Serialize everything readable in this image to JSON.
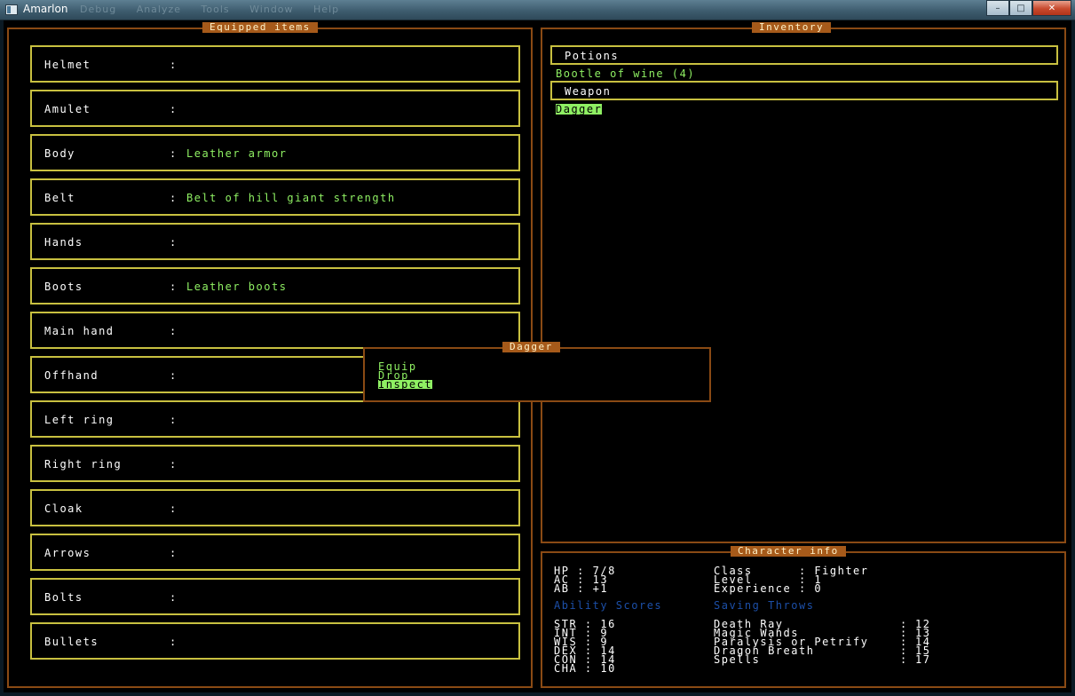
{
  "window": {
    "title": "Amarlon",
    "menu_ghosts": [
      "Debug",
      "Analyze",
      "Tools",
      "Window",
      "Help"
    ],
    "buttons": {
      "minimize": "–",
      "maximize": "□",
      "close": "✕"
    }
  },
  "equipped": {
    "title": "Equipped items",
    "slots": [
      {
        "slot": "Helmet",
        "item": ""
      },
      {
        "slot": "Amulet",
        "item": ""
      },
      {
        "slot": "Body",
        "item": "Leather armor"
      },
      {
        "slot": "Belt",
        "item": "Belt of hill giant strength"
      },
      {
        "slot": "Hands",
        "item": ""
      },
      {
        "slot": "Boots",
        "item": "Leather boots"
      },
      {
        "slot": "Main hand",
        "item": ""
      },
      {
        "slot": "Offhand",
        "item": ""
      },
      {
        "slot": "Left ring",
        "item": ""
      },
      {
        "slot": "Right ring",
        "item": ""
      },
      {
        "slot": "Cloak",
        "item": ""
      },
      {
        "slot": "Arrows",
        "item": ""
      },
      {
        "slot": "Bolts",
        "item": ""
      },
      {
        "slot": "Bullets",
        "item": ""
      }
    ]
  },
  "inventory": {
    "title": "Inventory",
    "categories": [
      {
        "name": "Potions",
        "items": [
          "Bootle of wine (4)"
        ]
      },
      {
        "name": "Weapon",
        "items": [
          "Dagger"
        ]
      }
    ],
    "selected_item": "Dagger"
  },
  "context_menu": {
    "title": "Dagger",
    "options": [
      "Equip",
      "Drop",
      "Inspect"
    ],
    "selected": "Inspect"
  },
  "character": {
    "title": "Character info",
    "stats": [
      "HP : 7/8",
      "AC : 13",
      "AB : +1"
    ],
    "class_info": [
      "Class      : Fighter",
      "Level      : 1",
      "Experience : 0"
    ],
    "ability_heading": "Ability Scores",
    "abilities": [
      "STR : 16",
      "INT : 9",
      "WIS : 9",
      "DEX : 14",
      "CON : 14",
      "CHA : 10"
    ],
    "saving_heading": "Saving Throws",
    "saves": [
      {
        "name": "Death Ray",
        "value": "12"
      },
      {
        "name": "Magic Wands",
        "value": "13"
      },
      {
        "name": "Paralysis or Petrify",
        "value": "14"
      },
      {
        "name": "Dragon Breath",
        "value": "15"
      },
      {
        "name": "Spells",
        "value": "17"
      }
    ],
    "accent_color": "#1c4fa8"
  },
  "colors": {
    "panel_border": "#8a4a14",
    "row_border": "#c8c040",
    "item_green": "#8ff063"
  }
}
